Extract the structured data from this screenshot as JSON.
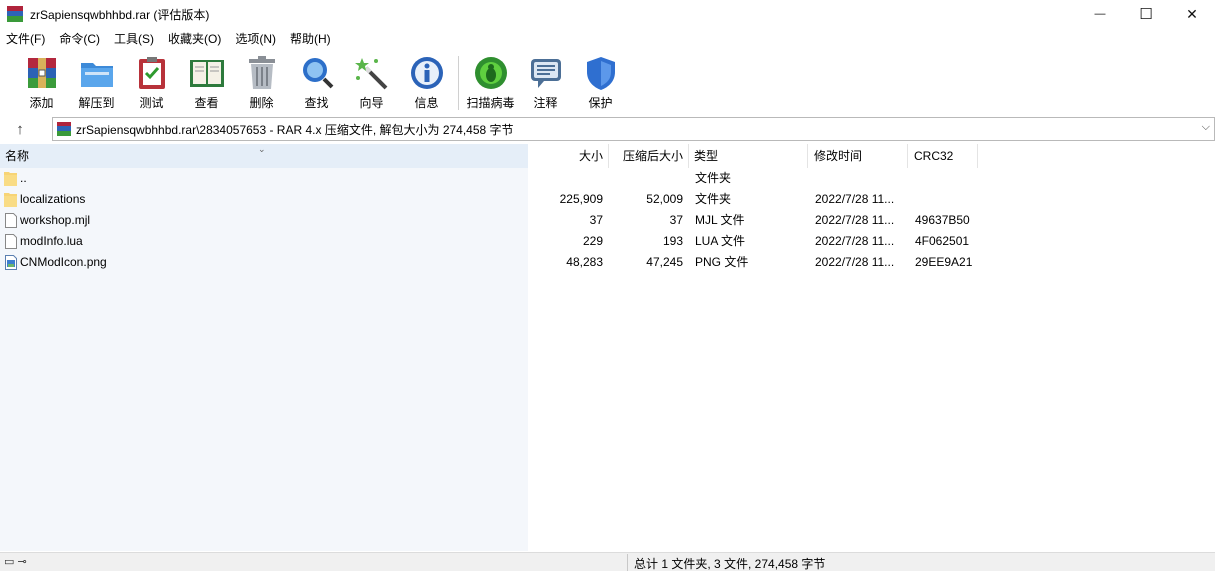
{
  "window": {
    "title": "zrSapiensqwbhhbd.rar (评估版本)",
    "controls": {
      "minimize": "—",
      "maximize": "☐",
      "close": "✕"
    }
  },
  "menu": [
    "文件(F)",
    "命令(C)",
    "工具(S)",
    "收藏夹(O)",
    "选项(N)",
    "帮助(H)"
  ],
  "toolbar": [
    {
      "label": "添加",
      "icon": "add-archive-icon"
    },
    {
      "label": "解压到",
      "icon": "extract-folder-icon"
    },
    {
      "label": "测试",
      "icon": "test-clipboard-icon"
    },
    {
      "label": "查看",
      "icon": "view-book-icon"
    },
    {
      "label": "删除",
      "icon": "trash-icon"
    },
    {
      "label": "查找",
      "icon": "magnifier-icon"
    },
    {
      "label": "向导",
      "icon": "wizard-wand-icon"
    },
    {
      "label": "信息",
      "icon": "info-icon"
    },
    {
      "label": "扫描病毒",
      "icon": "virus-scan-icon"
    },
    {
      "label": "注释",
      "icon": "comment-icon"
    },
    {
      "label": "保护",
      "icon": "shield-icon"
    }
  ],
  "address": {
    "path": "zrSapiensqwbhhbd.rar\\2834057653 - RAR 4.x 压缩文件, 解包大小为 274,458 字节"
  },
  "columns": {
    "name": "名称",
    "size": "大小",
    "packed": "压缩后大小",
    "type": "类型",
    "modified": "修改时间",
    "crc": "CRC32"
  },
  "files": [
    {
      "name": "..",
      "size": "",
      "packed": "",
      "type": "文件夹",
      "modified": "",
      "crc": "",
      "kind": "folder"
    },
    {
      "name": "localizations",
      "size": "225,909",
      "packed": "52,009",
      "type": "文件夹",
      "modified": "2022/7/28 11...",
      "crc": "",
      "kind": "folder"
    },
    {
      "name": "workshop.mjl",
      "size": "37",
      "packed": "37",
      "type": "MJL 文件",
      "modified": "2022/7/28 11...",
      "crc": "49637B50",
      "kind": "file"
    },
    {
      "name": "modInfo.lua",
      "size": "229",
      "packed": "193",
      "type": "LUA 文件",
      "modified": "2022/7/28 11...",
      "crc": "4F062501",
      "kind": "file"
    },
    {
      "name": "CNModIcon.png",
      "size": "48,283",
      "packed": "47,245",
      "type": "PNG 文件",
      "modified": "2022/7/28 11...",
      "crc": "29EE9A21",
      "kind": "image"
    }
  ],
  "status": {
    "summary": "总计 1 文件夹, 3 文件, 274,458 字节"
  },
  "colors": {
    "header_left": "#e5eef8",
    "pane_left": "#f4f7fb",
    "folder": "#f7d476"
  }
}
